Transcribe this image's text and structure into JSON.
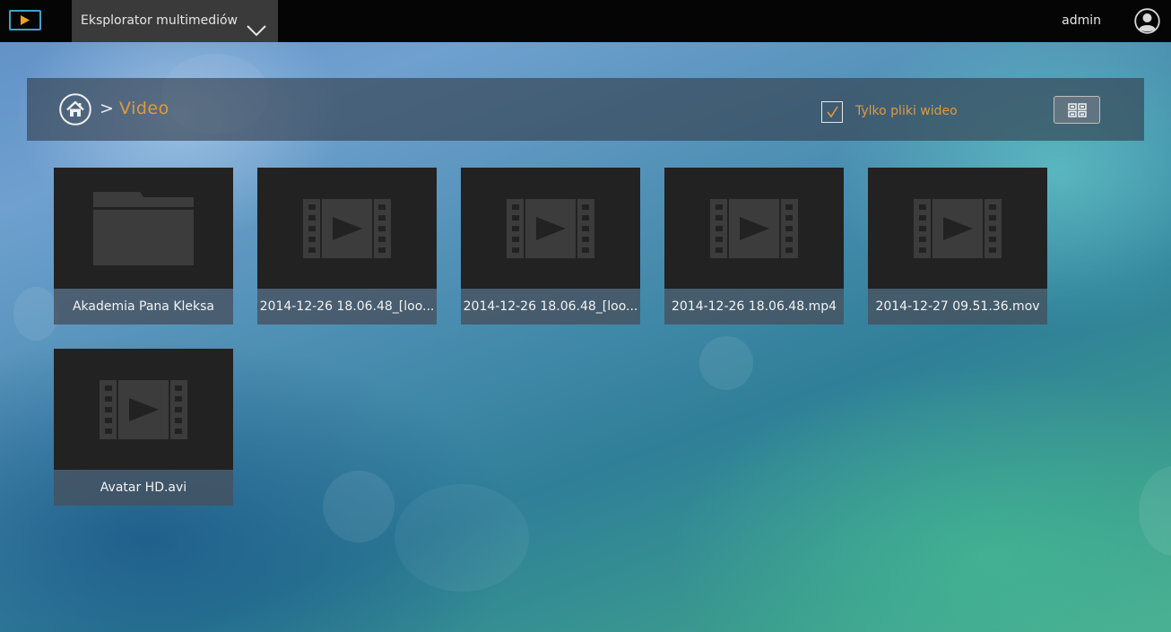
{
  "header": {
    "app_switcher_label": "Eksplorator multimediów",
    "user_name": "admin"
  },
  "breadcrumb": {
    "separator": ">",
    "current": "Video"
  },
  "filter": {
    "label": "Tylko pliki wideo",
    "checked": true
  },
  "colors": {
    "accent": "#e09a3c",
    "logo": "#3ea3c9",
    "tile_bg": "#222222",
    "icon": "#3c3c3c"
  },
  "items": [
    {
      "name": "Akademia Pana Kleksa",
      "icon": "folder-icon"
    },
    {
      "name": "2014-12-26 18.06.48_[loo...",
      "icon": "film-icon"
    },
    {
      "name": "2014-12-26 18.06.48_[loo...",
      "icon": "film-icon"
    },
    {
      "name": "2014-12-26 18.06.48.mp4",
      "icon": "film-icon"
    },
    {
      "name": "2014-12-27 09.51.36.mov",
      "icon": "film-icon"
    },
    {
      "name": "Avatar HD.avi",
      "icon": "film-icon"
    }
  ]
}
